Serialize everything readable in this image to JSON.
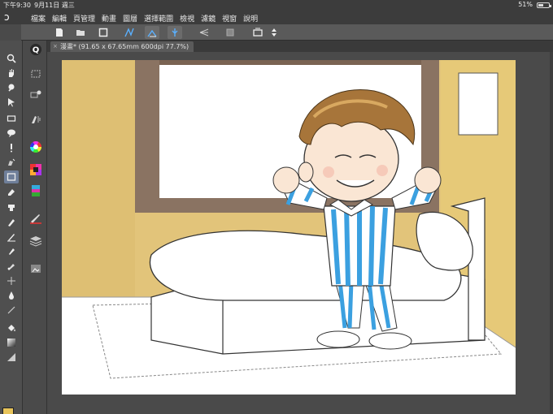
{
  "status": {
    "time": "下午9:30",
    "date": "9月11日 週三",
    "battery": "51%",
    "battery_level": 0.51
  },
  "menu": {
    "app_icon_glyph": "ↄ",
    "items": [
      "檔案",
      "編輯",
      "頁管理",
      "動畫",
      "圖層",
      "選擇範圍",
      "檢視",
      "濾鏡",
      "視窗",
      "說明"
    ]
  },
  "document": {
    "tab_close_glyph": "×",
    "tab_label": "漫畫* (91.65 x 67.65mm 600dpi 77.7%)"
  },
  "colors": {
    "main": "#e8c45a",
    "sub": "#ffffff",
    "accent": "#6f7f9a",
    "wall": "#e2c47a",
    "window_frame": "#8a7362",
    "pajama_blue": "#3ba0e0"
  }
}
